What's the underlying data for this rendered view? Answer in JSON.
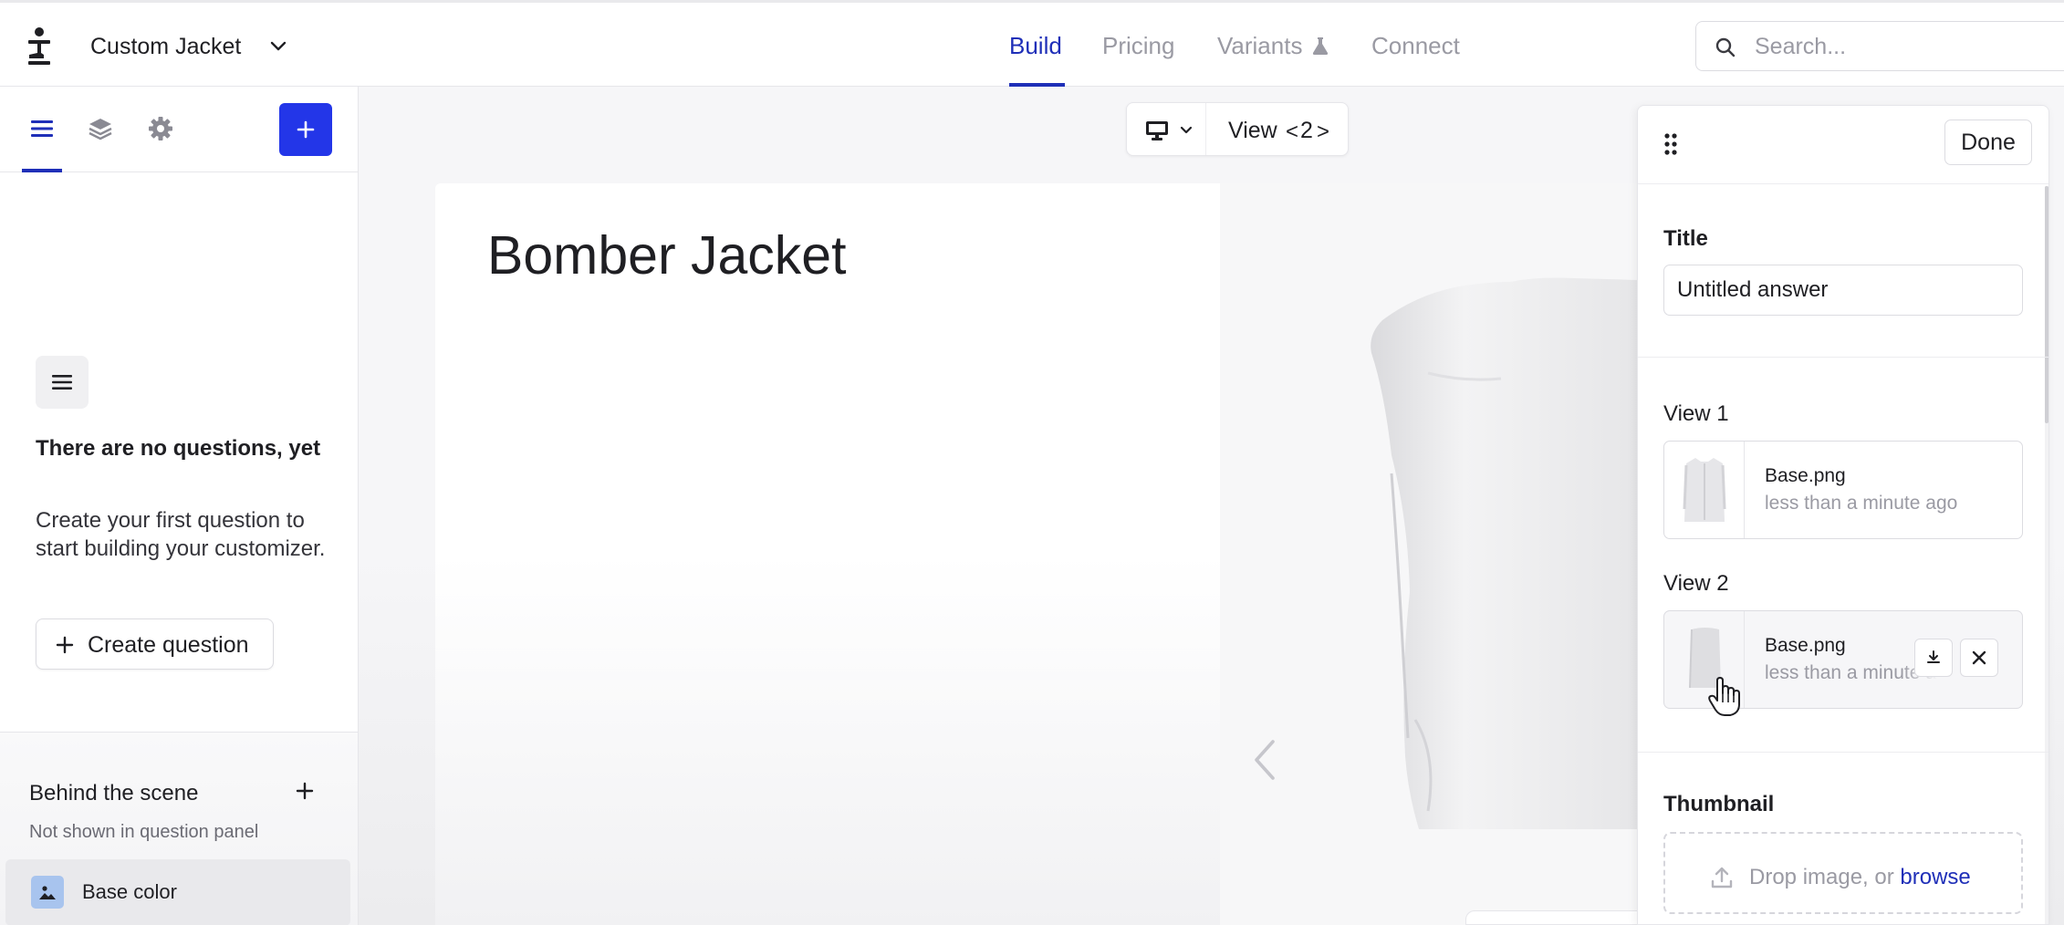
{
  "header": {
    "project_name": "Custom Jacket",
    "tabs": [
      {
        "label": "Build",
        "active": true
      },
      {
        "label": "Pricing",
        "active": false
      },
      {
        "label": "Variants",
        "active": false
      },
      {
        "label": "Connect",
        "active": false
      }
    ],
    "search_placeholder": "Search..."
  },
  "sidebar": {
    "tab_icons": [
      "list-icon",
      "layers-icon",
      "gear-icon"
    ],
    "add_button_icon": "plus-icon",
    "empty_state": {
      "title": "There are no questions, yet",
      "description": "Create your first question to start building your customizer.",
      "button_label": "Create question"
    },
    "behind_scene": {
      "title": "Behind the scene",
      "subtitle": "Not shown in question panel",
      "items": [
        {
          "label": "Base color",
          "icon": "image-icon"
        }
      ]
    }
  },
  "canvas": {
    "view_toolbar": {
      "label": "View",
      "prev": "<",
      "current": "2",
      "next": ">"
    },
    "product_title": "Bomber Jacket"
  },
  "answer_panel": {
    "done_label": "Done",
    "title_label": "Title",
    "title_value": "Untitled answer",
    "views": [
      {
        "label": "View 1",
        "file_name": "Base.png",
        "time": "less than a minute ago"
      },
      {
        "label": "View 2",
        "file_name": "Base.png",
        "time": "less than a minute ago"
      }
    ],
    "thumbnail_label": "Thumbnail",
    "drop_text": "Drop image, or ",
    "browse_label": "browse"
  },
  "colors": {
    "accent": "#1f2fb8",
    "primary_button": "#2336e8",
    "muted_text": "#9a9aa3"
  }
}
